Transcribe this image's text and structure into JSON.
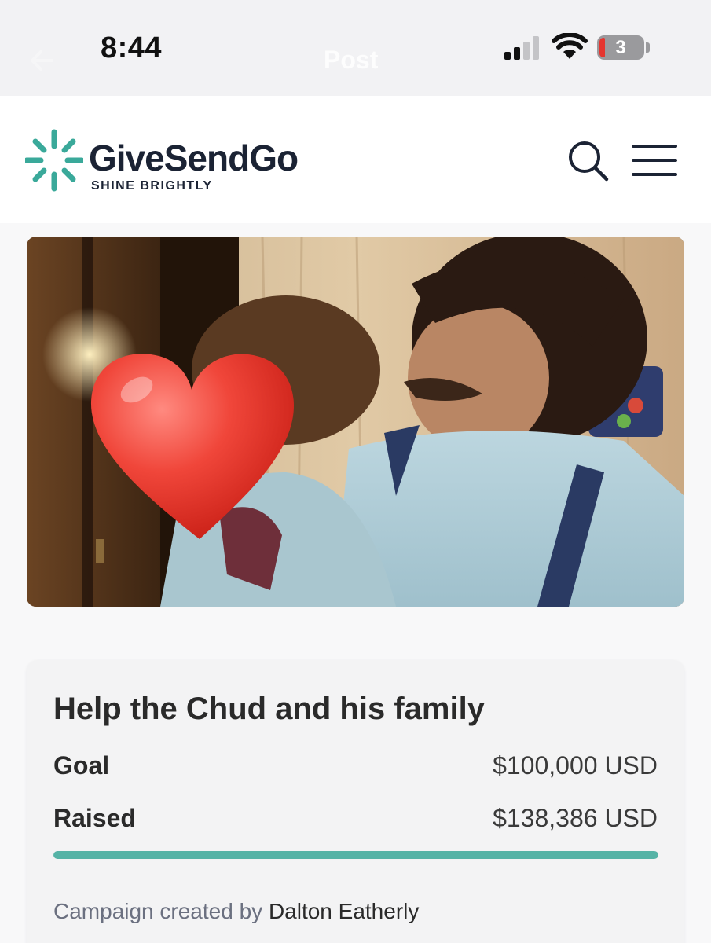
{
  "status_bar": {
    "time": "8:44",
    "battery_level": "3",
    "ghost_nav_title": "Post"
  },
  "header": {
    "brand_name": "GiveSendGo",
    "tagline": "SHINE BRIGHTLY",
    "search_icon": "search-icon",
    "menu_icon": "hamburger-menu-icon",
    "brand_color": "#3aa99a",
    "text_color": "#1b2334"
  },
  "hero": {
    "icon": "heart-emoji"
  },
  "campaign": {
    "title": "Help the Chud and his family",
    "goal_label": "Goal",
    "goal_value": "$100,000 USD",
    "raised_label": "Raised",
    "raised_value": "$138,386 USD",
    "progress_fraction": 1.0,
    "progress_color": "#55b3a6",
    "creator_prefix": "Campaign created by",
    "creator_name": "Dalton Eatherly"
  }
}
